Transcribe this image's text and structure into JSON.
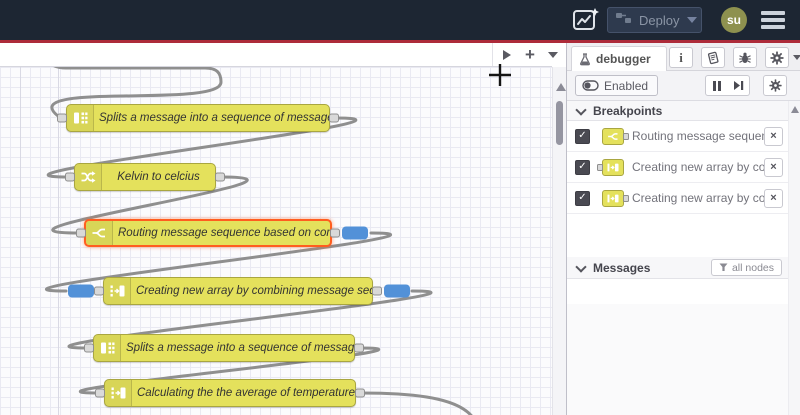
{
  "colors": {
    "header_bg": "#1d2633",
    "accent_red": "#ad2b3a",
    "node_yellow": "#e4e15c",
    "node_border": "#a9a640",
    "selected_orange": "#ff5e1f",
    "indicator_blue": "#5291d8",
    "avatar_olive": "#8e914f",
    "wire_gray": "#8f8f8f"
  },
  "header": {
    "deploy_label": "Deploy",
    "avatar_text": "su"
  },
  "workspace": {
    "nodes": [
      {
        "type": "split",
        "label": "Splits a message into a sequence of messages."
      },
      {
        "type": "change",
        "label": "Kelvin to celcius"
      },
      {
        "type": "switch",
        "label": "Routing message sequence based on condition",
        "selected": true
      },
      {
        "type": "join",
        "label": "Creating new array by combining message sequence"
      },
      {
        "type": "split",
        "label": "Splits a message into a sequence of messages."
      },
      {
        "type": "join",
        "label": "Calculating the the average of temperature"
      }
    ]
  },
  "sidebar": {
    "tab_label": "debugger",
    "enabled_label": "Enabled",
    "breakpoints": {
      "title": "Breakpoints",
      "items": [
        {
          "label": "Routing message sequence based on condition",
          "checked": true
        },
        {
          "label": "Creating new array by combining message sequence",
          "checked": true
        },
        {
          "label": "Creating new array by combining message sequence",
          "checked": true
        }
      ]
    },
    "messages": {
      "title": "Messages",
      "filter_label": "all nodes"
    }
  },
  "icons": {
    "close": "×",
    "plus": "+",
    "info": "i",
    "check": "✓"
  }
}
